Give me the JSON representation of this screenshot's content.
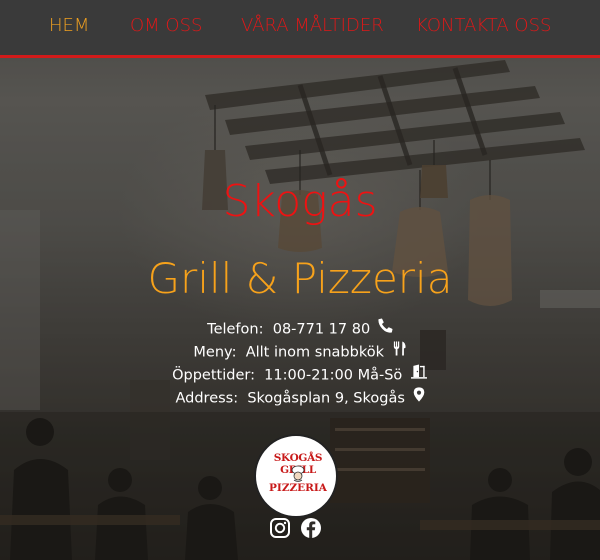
{
  "nav": {
    "items": [
      {
        "label": "HEM",
        "active": true
      },
      {
        "label": "OM OSS",
        "active": false
      },
      {
        "label": "VÅRA MÅLTIDER",
        "active": false
      },
      {
        "label": "KONTAKTA OSS",
        "active": false
      }
    ]
  },
  "hero": {
    "title_line1": "Skogås",
    "title_line2": "Grill & Pizzeria"
  },
  "info": {
    "phone_label": "Telefon:",
    "phone_value": "08-771 17 80",
    "menu_label": "Meny:",
    "menu_value": "Allt inom snabbkök",
    "hours_label": "Öppettider:",
    "hours_value": "11:00-21:00 Må-Sö",
    "address_label": "Address:",
    "address_value": "Skogåsplan 9, Skogås"
  },
  "logo": {
    "line1": "SKOGÅS GRILL",
    "line2": "PIZZERIA"
  },
  "social": {
    "icons": [
      "instagram-icon",
      "facebook-icon"
    ]
  },
  "colors": {
    "nav_bg": "#3a3a3a",
    "nav_border": "#d21a1a",
    "nav_text": "#e01818",
    "nav_active": "#f0a020",
    "title_red": "#ee1212",
    "title_orange": "#f7a21b"
  }
}
